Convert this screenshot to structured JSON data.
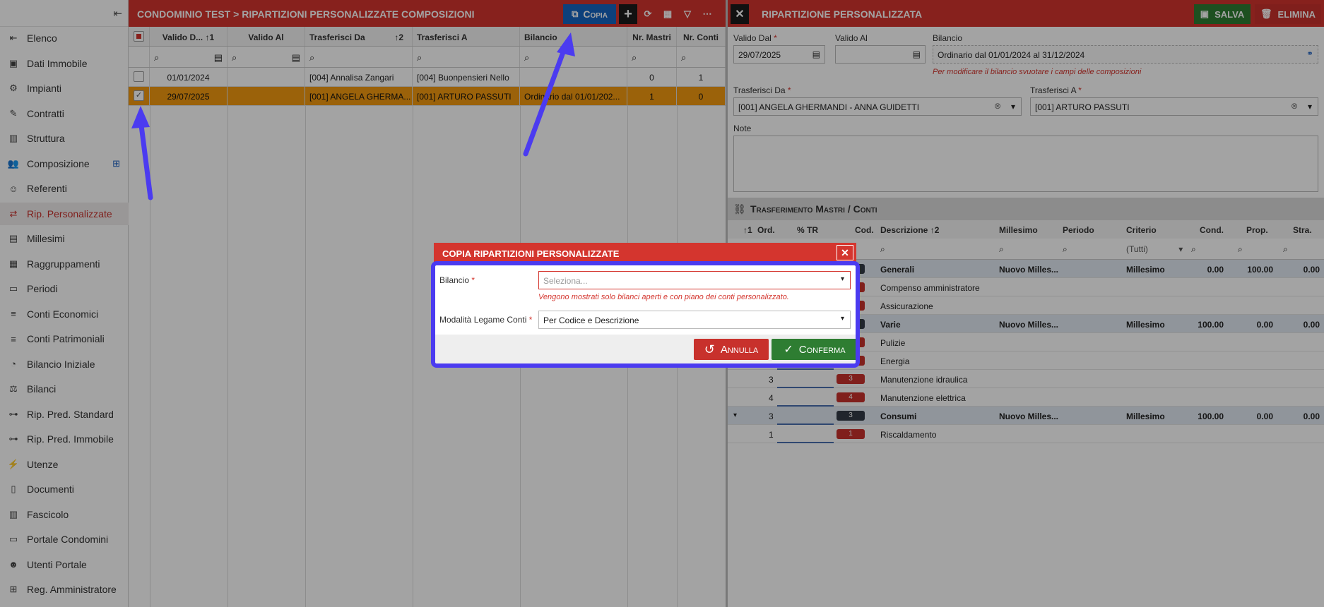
{
  "sidebar": {
    "items": [
      {
        "label": "Elenco",
        "icon": "list-icon"
      },
      {
        "label": "Dati Immobile",
        "icon": "building-card-icon"
      },
      {
        "label": "Impianti",
        "icon": "plant-icon"
      },
      {
        "label": "Contratti",
        "icon": "contract-icon"
      },
      {
        "label": "Struttura",
        "icon": "structure-icon"
      },
      {
        "label": "Composizione",
        "icon": "people-icon"
      },
      {
        "label": "Referenti",
        "icon": "contact-icon"
      },
      {
        "label": "Rip. Personalizzate",
        "icon": "route-icon"
      },
      {
        "label": "Millesimi",
        "icon": "table-icon"
      },
      {
        "label": "Raggruppamenti",
        "icon": "group-icon"
      },
      {
        "label": "Periodi",
        "icon": "calendar-icon"
      },
      {
        "label": "Conti Economici",
        "icon": "lines-icon"
      },
      {
        "label": "Conti Patrimoniali",
        "icon": "lines-icon"
      },
      {
        "label": "Bilancio Iniziale",
        "icon": "pie-icon"
      },
      {
        "label": "Bilanci",
        "icon": "balance-icon"
      },
      {
        "label": "Rip. Pred. Standard",
        "icon": "hierarchy-icon"
      },
      {
        "label": "Rip. Pred. Immobile",
        "icon": "hierarchy-icon"
      },
      {
        "label": "Utenze",
        "icon": "utility-icon"
      },
      {
        "label": "Documenti",
        "icon": "document-icon"
      },
      {
        "label": "Fascicolo",
        "icon": "books-icon"
      },
      {
        "label": "Portale Condomini",
        "icon": "window-icon"
      },
      {
        "label": "Utenti Portale",
        "icon": "user-icon"
      },
      {
        "label": "Reg. Amministratore",
        "icon": "register-icon"
      }
    ],
    "active_index": 7
  },
  "left_panel": {
    "breadcrumb_root": "CONDOMINIO TEST",
    "breadcrumb_sep": ">",
    "breadcrumb_page": "RIPARTIZIONI PERSONALIZZATE COMPOSIZIONI",
    "copy_label": "Copia",
    "columns": [
      "Valido D...",
      "Valido Al",
      "Trasferisci Da",
      "Trasferisci A",
      "Bilancio",
      "Nr. Mastri",
      "Nr. Conti"
    ],
    "sort1": "1",
    "sort2": "2",
    "rows": [
      {
        "valido_dal": "01/01/2024",
        "valido_al": "",
        "da": "[004] Annalisa Zangari",
        "a": "[004] Buonpensieri Nello",
        "bilancio": "",
        "mastri": "0",
        "conti": "1"
      },
      {
        "valido_dal": "29/07/2025",
        "valido_al": "",
        "da": "[001] ANGELA GHERMA...",
        "a": "[001] ARTURO PASSUTI",
        "bilancio": "Ordinario dal 01/01/202...",
        "mastri": "1",
        "conti": "0"
      }
    ]
  },
  "right_panel": {
    "title": "RIPARTIZIONE PERSONALIZZATA",
    "save_label": "SALVA",
    "delete_label": "ELIMINA",
    "valido_dal_label": "Valido Dal",
    "valido_dal_value": "29/07/2025",
    "valido_al_label": "Valido Al",
    "valido_al_value": "",
    "bilancio_label": "Bilancio",
    "bilancio_value": "Ordinario dal 01/01/2024 al 31/12/2024",
    "bilancio_hint": "Per modificare il bilancio svuotare i campi delle composizioni",
    "trasferisci_da_label": "Trasferisci Da",
    "trasferisci_da_value": "[001] ANGELA GHERMANDI - ANNA GUIDETTI",
    "trasferisci_a_label": "Trasferisci A",
    "trasferisci_a_value": "[001] ARTURO PASSUTI",
    "note_label": "Note",
    "tree_title": "Trasferimento Mastri / Conti",
    "tree_columns": {
      "ord": "Ord.",
      "tr": "% TR",
      "cod": "Cod.",
      "descr": "Descrizione",
      "millesimo": "Millesimo",
      "periodo": "Periodo",
      "criterio": "Criterio",
      "cond": "Cond.",
      "prop": "Prop.",
      "stra": "Stra."
    },
    "sort1": "1",
    "sort2": "2",
    "criterio_filter": "(Tutti)",
    "rows": [
      {
        "group": true,
        "ord": "",
        "code": "",
        "code_color": "#333a47",
        "descr": "Generali",
        "millesimo": "Nuovo Milles...",
        "criterio": "Millesimo",
        "cond": "0.00",
        "prop": "100.00",
        "stra": "0.00"
      },
      {
        "group": false,
        "ord": "",
        "code": "",
        "code_color": "#c8312c",
        "descr": "Compenso amministratore"
      },
      {
        "group": false,
        "ord": "",
        "code": "",
        "code_color": "#c8312c",
        "descr": "Assicurazione"
      },
      {
        "group": true,
        "ord": "",
        "code": "",
        "code_color": "#333a47",
        "descr": "Varie",
        "millesimo": "Nuovo Milles...",
        "criterio": "Millesimo",
        "cond": "100.00",
        "prop": "0.00",
        "stra": "0.00"
      },
      {
        "group": false,
        "ord": "",
        "code": "",
        "code_color": "#c8312c",
        "descr": "Pulizie"
      },
      {
        "group": false,
        "ord": "",
        "code": "",
        "code_color": "#c8312c",
        "descr": "Energia"
      },
      {
        "group": false,
        "ord": "3",
        "code": "3",
        "code_color": "#c8312c",
        "descr": "Manutenzione idraulica"
      },
      {
        "group": false,
        "ord": "4",
        "code": "4",
        "code_color": "#c8312c",
        "descr": "Manutenzione elettrica"
      },
      {
        "group": true,
        "expander": "▾",
        "ord": "3",
        "code": "3",
        "code_color": "#333a47",
        "descr": "Consumi",
        "millesimo": "Nuovo Milles...",
        "criterio": "Millesimo",
        "cond": "100.00",
        "prop": "0.00",
        "stra": "0.00"
      },
      {
        "group": false,
        "ord": "1",
        "code": "1",
        "code_color": "#c8312c",
        "descr": "Riscaldamento"
      }
    ]
  },
  "dialog": {
    "title": "COPIA RIPARTIZIONI PERSONALIZZATE",
    "bilancio_label": "Bilancio",
    "bilancio_placeholder": "Seleziona...",
    "bilancio_hint": "Vengono mostrati solo bilanci aperti e con piano dei conti personalizzato.",
    "modalita_label": "Modalità Legame Conti",
    "modalita_value": "Per Codice e Descrizione",
    "cancel_label": "Annulla",
    "confirm_label": "Conferma"
  },
  "colors": {
    "brand_red": "#d4352e",
    "selected_row": "#f39a10",
    "copy_blue": "#1565c0",
    "save_green": "#2e7d32",
    "annotation": "#4b3bf0"
  }
}
